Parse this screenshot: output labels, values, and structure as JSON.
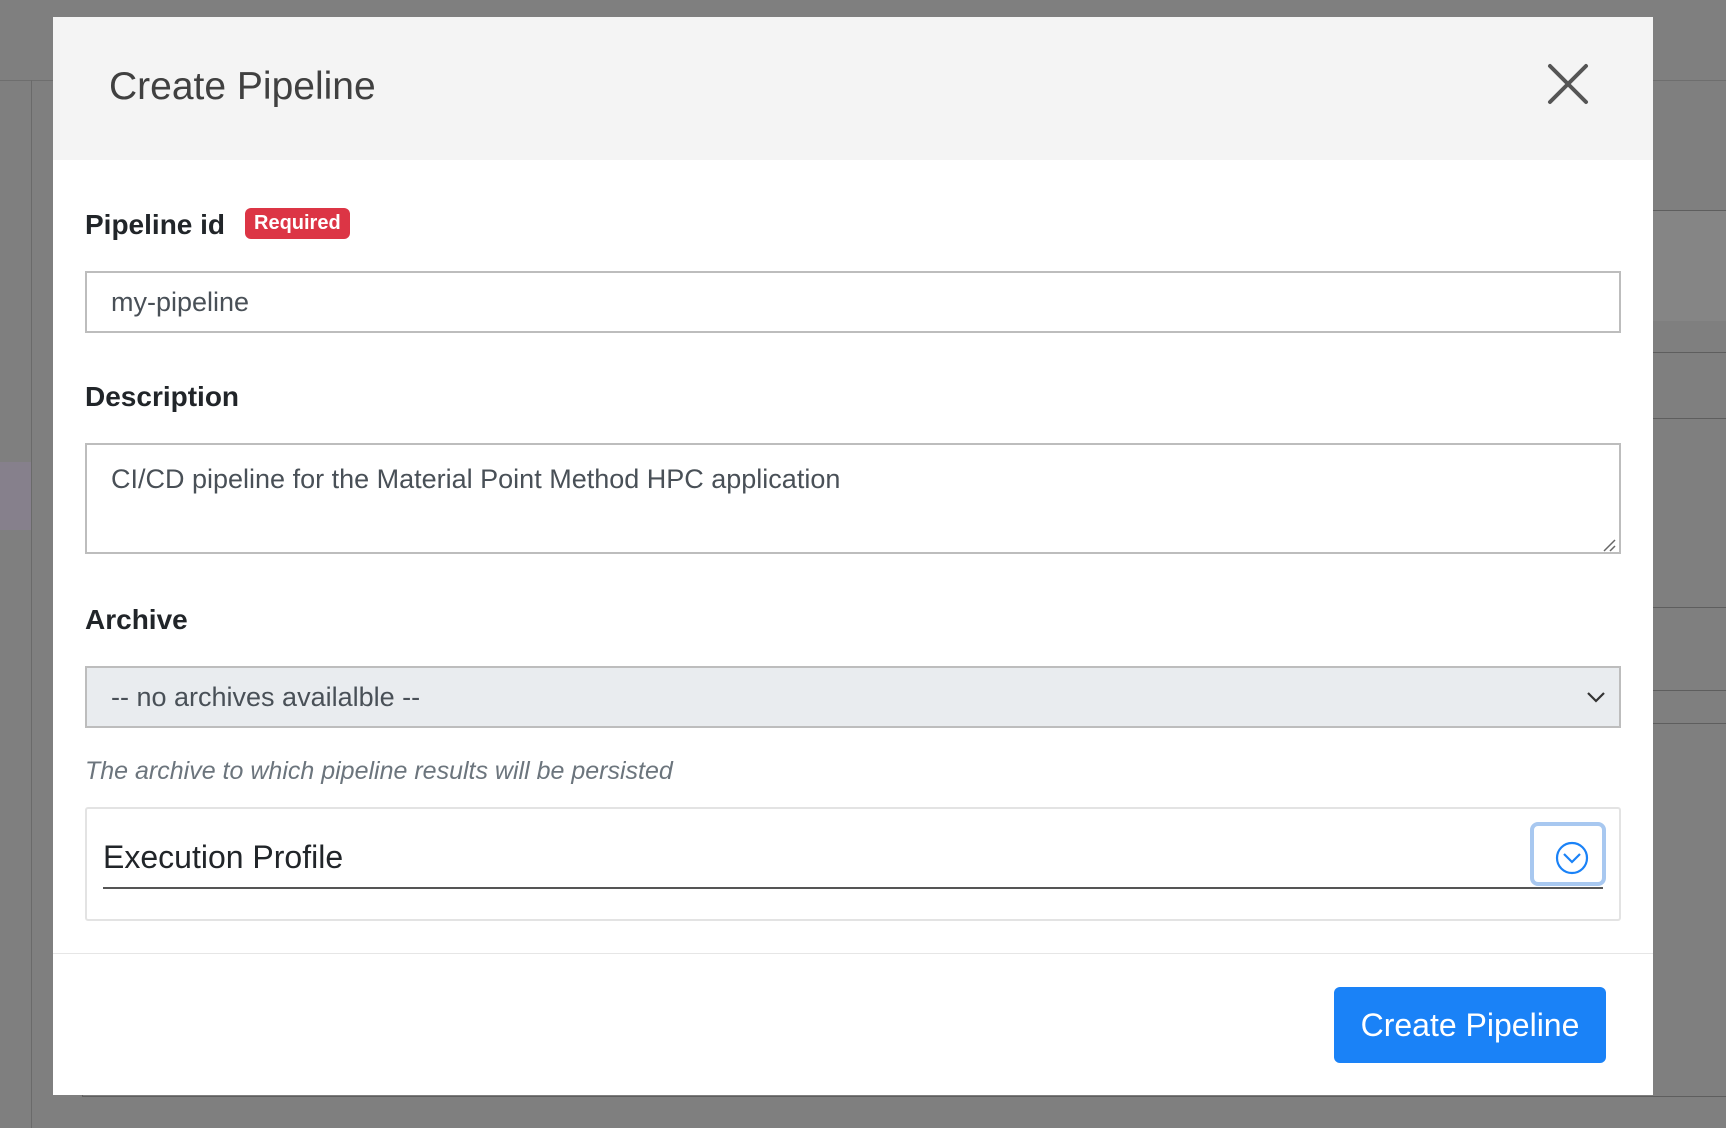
{
  "modal": {
    "title": "Create Pipeline",
    "close_icon": "close-icon"
  },
  "form": {
    "pipeline_id": {
      "label": "Pipeline id",
      "badge": "Required",
      "value": "my-pipeline"
    },
    "description": {
      "label": "Description",
      "value": "CI/CD pipeline for the Material Point Method HPC application"
    },
    "archive": {
      "label": "Archive",
      "selected": "-- no archives availalble --",
      "help": "The archive to which pipeline results will be persisted"
    },
    "execution_profile": {
      "title": "Execution Profile",
      "expand_icon": "chevron-down-circle-icon"
    }
  },
  "footer": {
    "submit_label": "Create Pipeline"
  },
  "colors": {
    "primary": "#1a82f7",
    "danger": "#dc3545",
    "overlay": "#7f7f7f"
  }
}
